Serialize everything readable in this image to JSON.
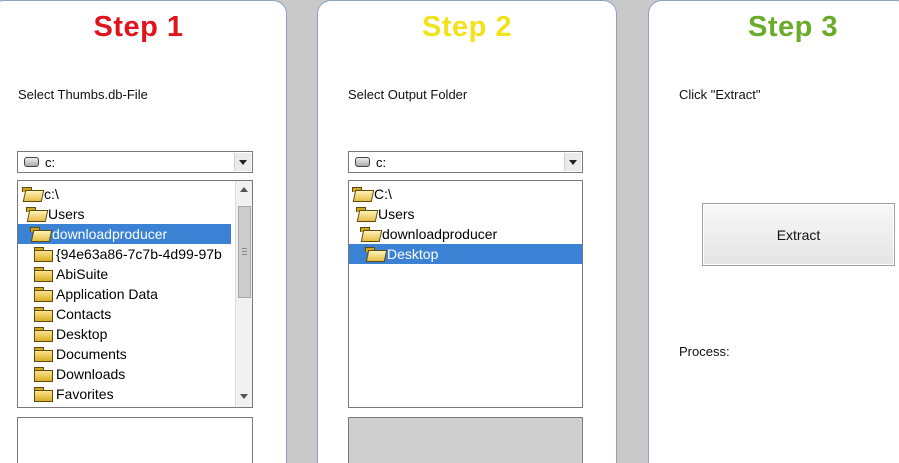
{
  "colors": {
    "step1": "#e0141e",
    "step2": "#f2e21c",
    "step3": "#6aac2a",
    "selection": "#3b82d4"
  },
  "step1": {
    "title": "Step 1",
    "instruction": "Select Thumbs.db-File",
    "drive": "c:",
    "tree": [
      {
        "label": "c:\\",
        "icon": "open-folder-icon",
        "selected": false
      },
      {
        "label": "Users",
        "icon": "open-folder-icon",
        "selected": false
      },
      {
        "label": "downloadproducer",
        "icon": "open-folder-icon",
        "selected": true
      },
      {
        "label": "{94e63a86-7c7b-4d99-97b",
        "icon": "folder-icon",
        "selected": false
      },
      {
        "label": "AbiSuite",
        "icon": "folder-icon",
        "selected": false
      },
      {
        "label": "Application Data",
        "icon": "folder-icon",
        "selected": false
      },
      {
        "label": "Contacts",
        "icon": "folder-icon",
        "selected": false
      },
      {
        "label": "Desktop",
        "icon": "folder-icon",
        "selected": false
      },
      {
        "label": "Documents",
        "icon": "folder-icon",
        "selected": false
      },
      {
        "label": "Downloads",
        "icon": "folder-icon",
        "selected": false
      },
      {
        "label": "Favorites",
        "icon": "folder-icon",
        "selected": false
      }
    ]
  },
  "step2": {
    "title": "Step 2",
    "instruction": "Select Output Folder",
    "drive": "c:",
    "tree": [
      {
        "label": "C:\\",
        "icon": "open-folder-icon",
        "selected": false
      },
      {
        "label": "Users",
        "icon": "open-folder-icon",
        "selected": false
      },
      {
        "label": "downloadproducer",
        "icon": "open-folder-icon",
        "selected": false
      },
      {
        "label": "Desktop",
        "icon": "open-folder-icon",
        "selected": true
      }
    ]
  },
  "step3": {
    "title": "Step 3",
    "instruction": "Click \"Extract\"",
    "button": "Extract",
    "process_label": "Process:"
  }
}
